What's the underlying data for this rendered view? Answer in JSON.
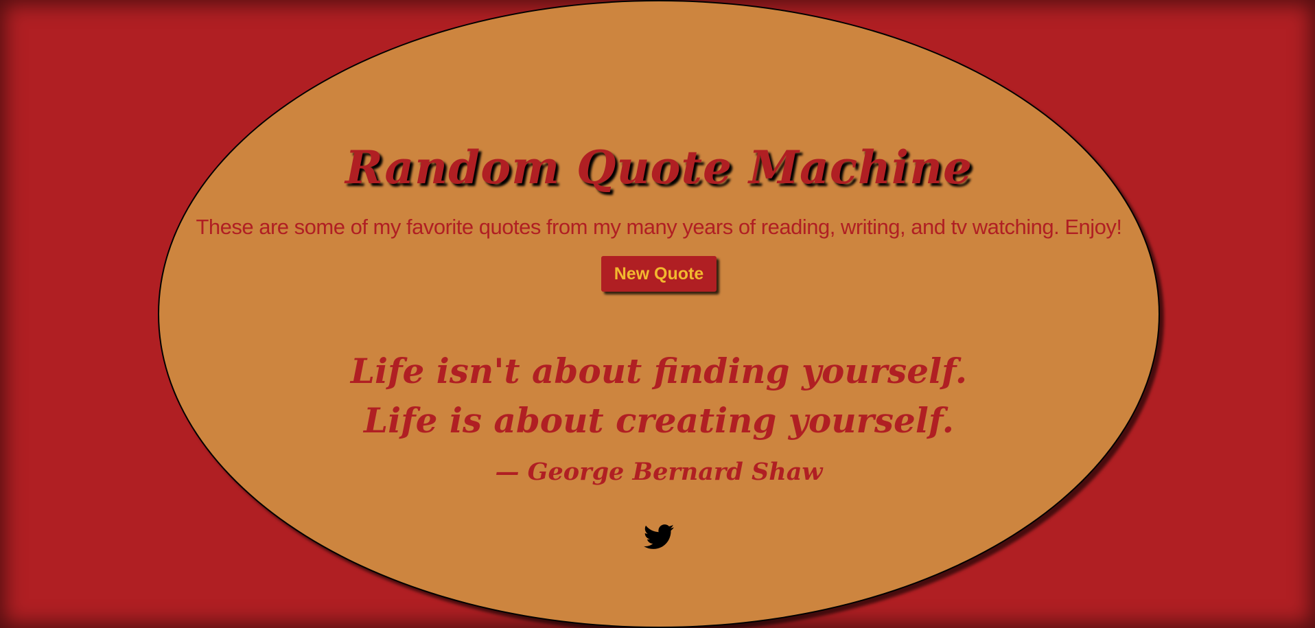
{
  "header": {
    "title": "Random Quote Machine",
    "subtitle": "These are some of my favorite quotes from my many years of reading, writing, and tv watching. Enjoy!"
  },
  "controls": {
    "new_quote_label": "New Quote"
  },
  "quote": {
    "text": "Life isn't about finding yourself. Life is about creating yourself.",
    "author": "— George Bernard Shaw"
  },
  "share": {
    "icon": "twitter-icon"
  },
  "colors": {
    "background": "#b01f23",
    "ellipse": "#cd853f",
    "accent_text": "#b01f23",
    "button_text": "#f2b92f"
  }
}
